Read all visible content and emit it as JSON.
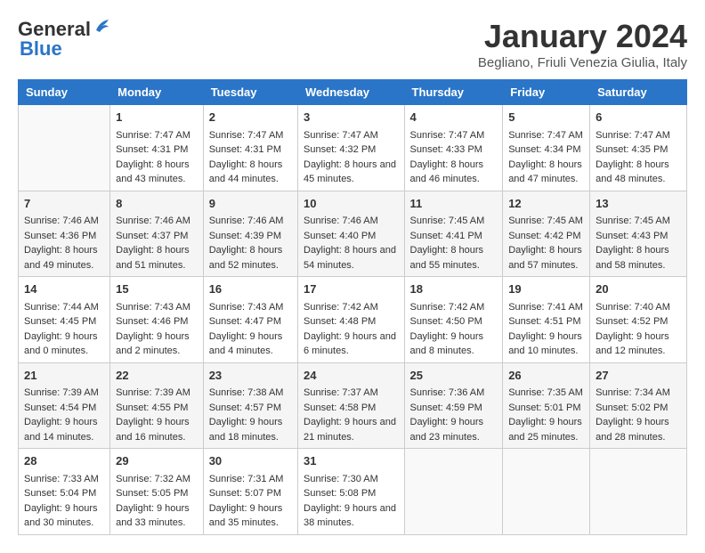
{
  "header": {
    "logo_general": "General",
    "logo_blue": "Blue",
    "month_title": "January 2024",
    "location": "Begliano, Friuli Venezia Giulia, Italy"
  },
  "weekdays": [
    "Sunday",
    "Monday",
    "Tuesday",
    "Wednesday",
    "Thursday",
    "Friday",
    "Saturday"
  ],
  "weeks": [
    [
      {
        "day": "",
        "sunrise": "",
        "sunset": "",
        "daylight": ""
      },
      {
        "day": "1",
        "sunrise": "Sunrise: 7:47 AM",
        "sunset": "Sunset: 4:31 PM",
        "daylight": "Daylight: 8 hours and 43 minutes."
      },
      {
        "day": "2",
        "sunrise": "Sunrise: 7:47 AM",
        "sunset": "Sunset: 4:31 PM",
        "daylight": "Daylight: 8 hours and 44 minutes."
      },
      {
        "day": "3",
        "sunrise": "Sunrise: 7:47 AM",
        "sunset": "Sunset: 4:32 PM",
        "daylight": "Daylight: 8 hours and 45 minutes."
      },
      {
        "day": "4",
        "sunrise": "Sunrise: 7:47 AM",
        "sunset": "Sunset: 4:33 PM",
        "daylight": "Daylight: 8 hours and 46 minutes."
      },
      {
        "day": "5",
        "sunrise": "Sunrise: 7:47 AM",
        "sunset": "Sunset: 4:34 PM",
        "daylight": "Daylight: 8 hours and 47 minutes."
      },
      {
        "day": "6",
        "sunrise": "Sunrise: 7:47 AM",
        "sunset": "Sunset: 4:35 PM",
        "daylight": "Daylight: 8 hours and 48 minutes."
      }
    ],
    [
      {
        "day": "7",
        "sunrise": "Sunrise: 7:46 AM",
        "sunset": "Sunset: 4:36 PM",
        "daylight": "Daylight: 8 hours and 49 minutes."
      },
      {
        "day": "8",
        "sunrise": "Sunrise: 7:46 AM",
        "sunset": "Sunset: 4:37 PM",
        "daylight": "Daylight: 8 hours and 51 minutes."
      },
      {
        "day": "9",
        "sunrise": "Sunrise: 7:46 AM",
        "sunset": "Sunset: 4:39 PM",
        "daylight": "Daylight: 8 hours and 52 minutes."
      },
      {
        "day": "10",
        "sunrise": "Sunrise: 7:46 AM",
        "sunset": "Sunset: 4:40 PM",
        "daylight": "Daylight: 8 hours and 54 minutes."
      },
      {
        "day": "11",
        "sunrise": "Sunrise: 7:45 AM",
        "sunset": "Sunset: 4:41 PM",
        "daylight": "Daylight: 8 hours and 55 minutes."
      },
      {
        "day": "12",
        "sunrise": "Sunrise: 7:45 AM",
        "sunset": "Sunset: 4:42 PM",
        "daylight": "Daylight: 8 hours and 57 minutes."
      },
      {
        "day": "13",
        "sunrise": "Sunrise: 7:45 AM",
        "sunset": "Sunset: 4:43 PM",
        "daylight": "Daylight: 8 hours and 58 minutes."
      }
    ],
    [
      {
        "day": "14",
        "sunrise": "Sunrise: 7:44 AM",
        "sunset": "Sunset: 4:45 PM",
        "daylight": "Daylight: 9 hours and 0 minutes."
      },
      {
        "day": "15",
        "sunrise": "Sunrise: 7:43 AM",
        "sunset": "Sunset: 4:46 PM",
        "daylight": "Daylight: 9 hours and 2 minutes."
      },
      {
        "day": "16",
        "sunrise": "Sunrise: 7:43 AM",
        "sunset": "Sunset: 4:47 PM",
        "daylight": "Daylight: 9 hours and 4 minutes."
      },
      {
        "day": "17",
        "sunrise": "Sunrise: 7:42 AM",
        "sunset": "Sunset: 4:48 PM",
        "daylight": "Daylight: 9 hours and 6 minutes."
      },
      {
        "day": "18",
        "sunrise": "Sunrise: 7:42 AM",
        "sunset": "Sunset: 4:50 PM",
        "daylight": "Daylight: 9 hours and 8 minutes."
      },
      {
        "day": "19",
        "sunrise": "Sunrise: 7:41 AM",
        "sunset": "Sunset: 4:51 PM",
        "daylight": "Daylight: 9 hours and 10 minutes."
      },
      {
        "day": "20",
        "sunrise": "Sunrise: 7:40 AM",
        "sunset": "Sunset: 4:52 PM",
        "daylight": "Daylight: 9 hours and 12 minutes."
      }
    ],
    [
      {
        "day": "21",
        "sunrise": "Sunrise: 7:39 AM",
        "sunset": "Sunset: 4:54 PM",
        "daylight": "Daylight: 9 hours and 14 minutes."
      },
      {
        "day": "22",
        "sunrise": "Sunrise: 7:39 AM",
        "sunset": "Sunset: 4:55 PM",
        "daylight": "Daylight: 9 hours and 16 minutes."
      },
      {
        "day": "23",
        "sunrise": "Sunrise: 7:38 AM",
        "sunset": "Sunset: 4:57 PM",
        "daylight": "Daylight: 9 hours and 18 minutes."
      },
      {
        "day": "24",
        "sunrise": "Sunrise: 7:37 AM",
        "sunset": "Sunset: 4:58 PM",
        "daylight": "Daylight: 9 hours and 21 minutes."
      },
      {
        "day": "25",
        "sunrise": "Sunrise: 7:36 AM",
        "sunset": "Sunset: 4:59 PM",
        "daylight": "Daylight: 9 hours and 23 minutes."
      },
      {
        "day": "26",
        "sunrise": "Sunrise: 7:35 AM",
        "sunset": "Sunset: 5:01 PM",
        "daylight": "Daylight: 9 hours and 25 minutes."
      },
      {
        "day": "27",
        "sunrise": "Sunrise: 7:34 AM",
        "sunset": "Sunset: 5:02 PM",
        "daylight": "Daylight: 9 hours and 28 minutes."
      }
    ],
    [
      {
        "day": "28",
        "sunrise": "Sunrise: 7:33 AM",
        "sunset": "Sunset: 5:04 PM",
        "daylight": "Daylight: 9 hours and 30 minutes."
      },
      {
        "day": "29",
        "sunrise": "Sunrise: 7:32 AM",
        "sunset": "Sunset: 5:05 PM",
        "daylight": "Daylight: 9 hours and 33 minutes."
      },
      {
        "day": "30",
        "sunrise": "Sunrise: 7:31 AM",
        "sunset": "Sunset: 5:07 PM",
        "daylight": "Daylight: 9 hours and 35 minutes."
      },
      {
        "day": "31",
        "sunrise": "Sunrise: 7:30 AM",
        "sunset": "Sunset: 5:08 PM",
        "daylight": "Daylight: 9 hours and 38 minutes."
      },
      {
        "day": "",
        "sunrise": "",
        "sunset": "",
        "daylight": ""
      },
      {
        "day": "",
        "sunrise": "",
        "sunset": "",
        "daylight": ""
      },
      {
        "day": "",
        "sunrise": "",
        "sunset": "",
        "daylight": ""
      }
    ]
  ]
}
